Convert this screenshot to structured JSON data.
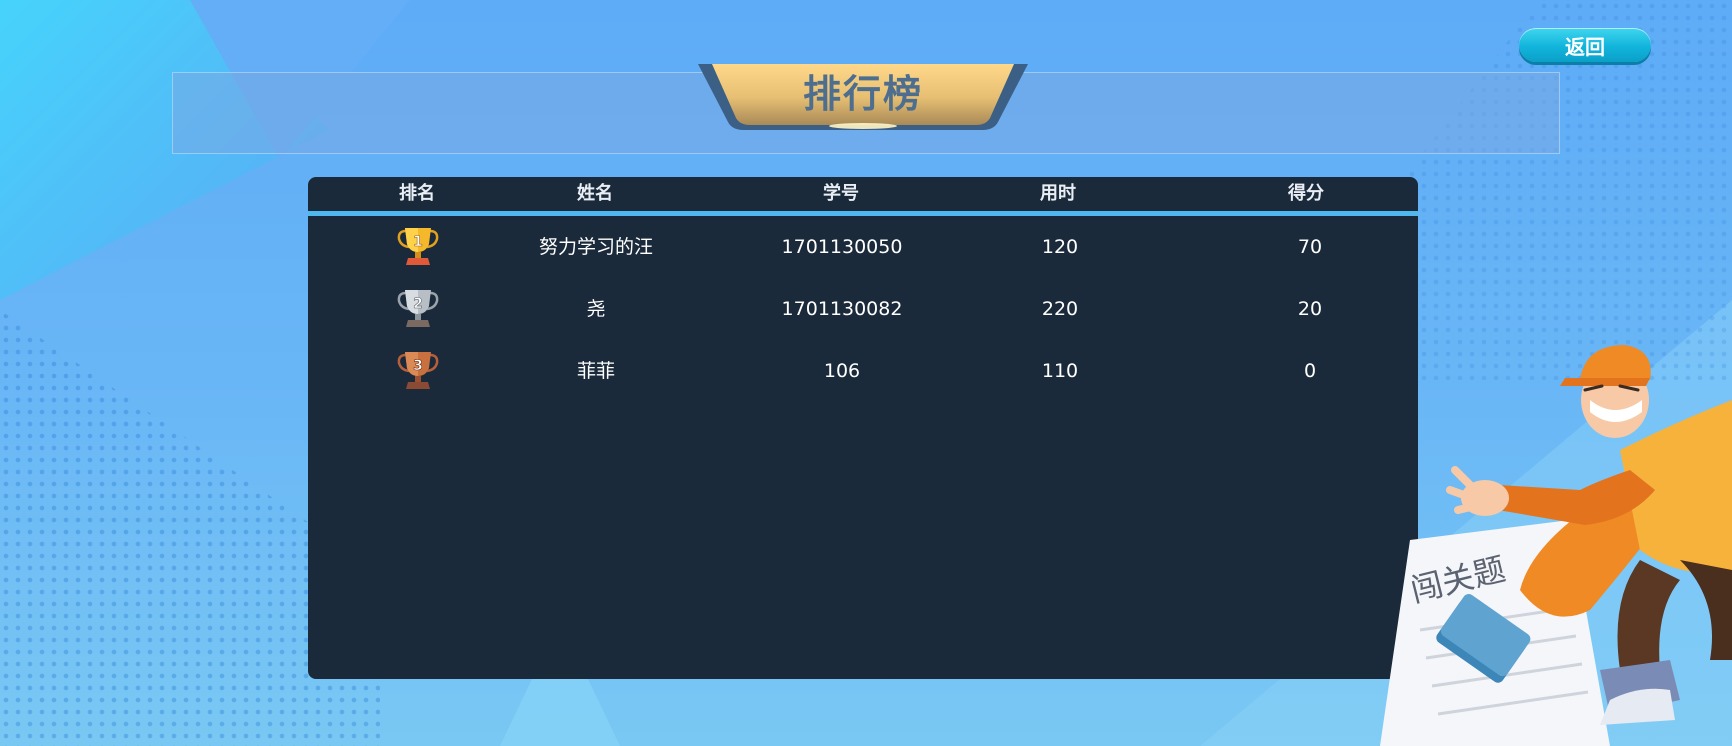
{
  "title": "排行榜",
  "back_button": {
    "label": "返回"
  },
  "colors": {
    "background": "#5eabf7",
    "board": "#1b2a3a",
    "divider": "#4fb9ee",
    "title_plate": "#e6bf73",
    "back_button": "#12b4dc"
  },
  "table": {
    "columns": [
      "排名",
      "姓名",
      "学号",
      "用时",
      "得分"
    ],
    "rows": [
      {
        "rank": "1",
        "rank_icon": "gold-trophy-icon",
        "name": "努力学习的汪",
        "student_id": "1701130050",
        "time": "120",
        "score": "70"
      },
      {
        "rank": "2",
        "rank_icon": "silver-trophy-icon",
        "name": "尧",
        "student_id": "1701130082",
        "time": "220",
        "score": "20"
      },
      {
        "rank": "3",
        "rank_icon": "bronze-trophy-icon",
        "name": "菲菲",
        "student_id": "106",
        "time": "110",
        "score": "0"
      }
    ]
  },
  "illustration": {
    "paper_text": "闯关题"
  }
}
